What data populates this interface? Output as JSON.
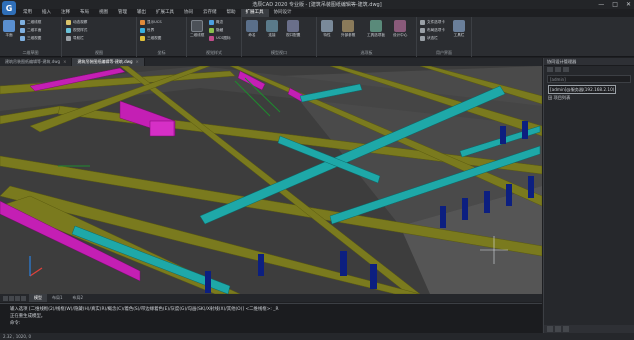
{
  "app": {
    "title": "浩辰CAD 2020 专业版 - [建筑吊装图纸编辑等-建筑.dwg]",
    "logo_letter": "G"
  },
  "window_controls": {
    "minimize": "—",
    "maximize": "□",
    "close": "✕"
  },
  "menu": [
    "常用",
    "插入",
    "注释",
    "布局",
    "视图",
    "管理",
    "输出",
    "扩展工具",
    "协同",
    "云存储",
    "帮助",
    "扩展工具",
    "协同设计"
  ],
  "menu_active_index": 11,
  "ribbon": {
    "groups": [
      {
        "label": "二维草图"
      },
      {
        "label": "视图"
      },
      {
        "label": "坐标"
      },
      {
        "label": "视觉样式"
      },
      {
        "label": "模型视口"
      },
      {
        "label": "选项板"
      },
      {
        "label": "用户界面"
      }
    ],
    "buttons": {
      "plane": "平面",
      "viewport": "二维线框",
      "threed": "三维导航",
      "model_view": "模型视口",
      "named": "命名",
      "sheet": "连接",
      "window": "工具选项板",
      "props": "特性",
      "external": "外部参照",
      "tool_palette": "工具选项板",
      "design_center": "设计中心",
      "toolbars": "工具栏"
    },
    "small_items": [
      "二维线框",
      "二维平面",
      "三维视图",
      "动态观察",
      "视觉样式",
      "导航栏",
      "显示UCS",
      "世界",
      "三维视图",
      "平面视图",
      "二维线框",
      "概念",
      "隐藏",
      "UCS图标",
      "命名视口",
      "合并视口",
      "视口配置",
      "新建",
      "文件选项卡",
      "布局选项卡",
      "状态栏"
    ]
  },
  "doc_tabs": [
    {
      "label": "建筑吊装图纸编辑等-建筑.dwg",
      "active": false
    },
    {
      "label": "建筑吊装图纸编辑等-建筑.dwg",
      "active": true
    }
  ],
  "layout_tabs": [
    "模型",
    "布局1",
    "布局2"
  ],
  "command": {
    "history": [
      "输入选项 [二维线框(2)/线框(W)/隐藏(H)/真实(R)/概念(C)/着色(S)/带边缘着色(E)/灰度(G)/勾画(SK)/X射线(X)/其他(O)] <二维线框>: _R",
      "正在重生成模型。"
    ],
    "prompt": "命令:"
  },
  "status": {
    "coords": "2.32 , 1020, 0"
  },
  "right_panel": {
    "title": "协同设计管理器",
    "search_placeholder": "[admin]",
    "items": [
      "[admin]@服务器(192.168.2.10)",
      "田 项目列表"
    ]
  },
  "colors": {
    "viewport_bg": "#3b3b3b",
    "duct_magenta": "#c41fb4",
    "duct_cyan": "#1ea8a8",
    "beam_olive": "#7a7a1e",
    "window_blue": "#0c1f80"
  }
}
